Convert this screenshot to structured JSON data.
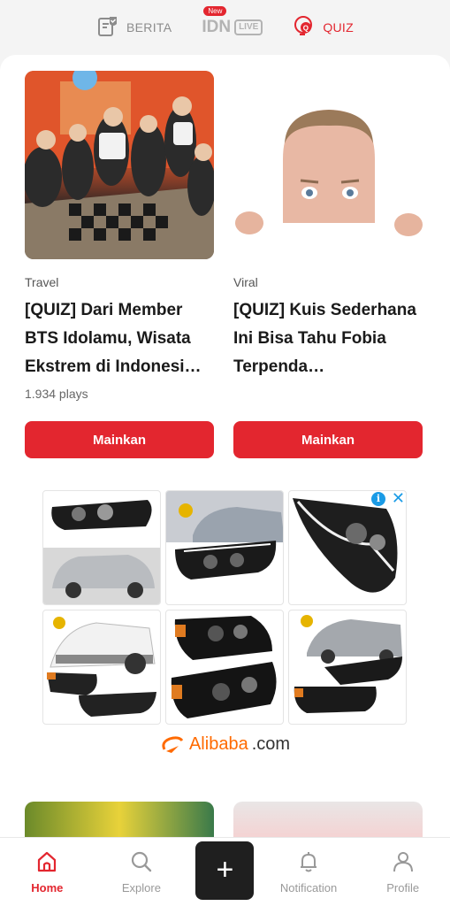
{
  "top_tabs": [
    {
      "label": "BERITA",
      "icon": "news-check-icon",
      "active": false
    },
    {
      "label": "IDN",
      "badge": "New",
      "live": "LIVE",
      "active": false
    },
    {
      "label": "QUIZ",
      "icon": "quiz-bulb-icon",
      "active": true
    }
  ],
  "quiz_cards": [
    {
      "category": "Travel",
      "title": "[QUIZ] Dari Member BTS Idolamu, Wisata Ekstrem di Indonesi…",
      "plays": "1.934 plays",
      "button": "Mainkan"
    },
    {
      "category": "Viral",
      "title": "[QUIZ] Kuis Sederhana Ini Bisa Tahu Fobia Terpenda…",
      "plays": "",
      "button": "Mainkan"
    }
  ],
  "ad": {
    "info": "i",
    "close": "✕",
    "brand_name": "Alibaba",
    "brand_domain": ".com"
  },
  "bottom_nav": [
    {
      "label": "Home",
      "icon": "home-icon",
      "active": true
    },
    {
      "label": "Explore",
      "icon": "search-icon",
      "active": false
    },
    {
      "label": "+",
      "icon": "plus-icon",
      "active": false
    },
    {
      "label": "Notification",
      "icon": "bell-icon",
      "active": false
    },
    {
      "label": "Profile",
      "icon": "person-icon",
      "active": false
    }
  ],
  "colors": {
    "accent": "#e3262f",
    "fab": "#1f1f1f",
    "ad_link": "#1a9be6",
    "alibaba": "#ff6a00"
  }
}
